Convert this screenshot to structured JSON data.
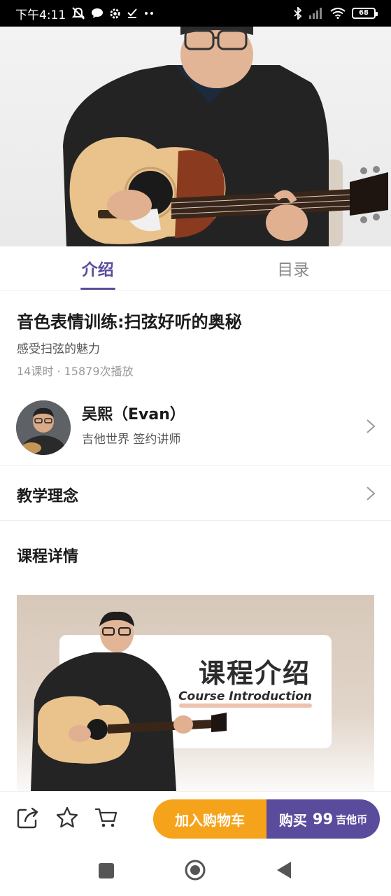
{
  "status_bar": {
    "time": "下午4:11",
    "battery": "68",
    "icons": [
      "mute-icon",
      "message-icon",
      "settings-icon",
      "download-done-icon",
      "more-icon",
      "bluetooth-icon",
      "signal-icon",
      "wifi-icon",
      "battery-icon"
    ]
  },
  "tabs": [
    {
      "label": "介绍",
      "active": true
    },
    {
      "label": "目录",
      "active": false
    }
  ],
  "course": {
    "title": "音色表情训练:扫弦好听的奥秘",
    "subtitle": "感受扫弦的魅力",
    "stats": "14课时 · 15879次播放"
  },
  "instructor": {
    "name": "吴熙（Evan）",
    "role": "吉他世界 签约讲师"
  },
  "sections": {
    "philosophy": "教学理念",
    "details": "课程详情"
  },
  "banner": {
    "heading": "课程介绍",
    "subheading": "Course Introduction"
  },
  "actions": {
    "icons": [
      "share-icon",
      "star-icon",
      "cart-icon"
    ],
    "add_to_cart": "加入购物车",
    "buy_label": "购买",
    "price": "99",
    "currency": "吉他币"
  },
  "colors": {
    "accent": "#5b4b9c",
    "cart": "#f5a31a"
  }
}
